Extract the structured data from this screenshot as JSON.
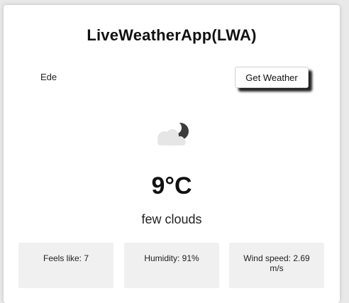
{
  "app": {
    "title": "LiveWeatherApp(LWA)"
  },
  "search": {
    "city_value": "Ede",
    "button_label": "Get Weather"
  },
  "weather": {
    "icon": "few-clouds-night-icon",
    "temperature": "9°C",
    "description": "few clouds"
  },
  "details": {
    "feels_like": "Feels like: 7",
    "humidity": "Humidity: 91%",
    "wind_speed": "Wind speed: 2.69 m/s"
  }
}
